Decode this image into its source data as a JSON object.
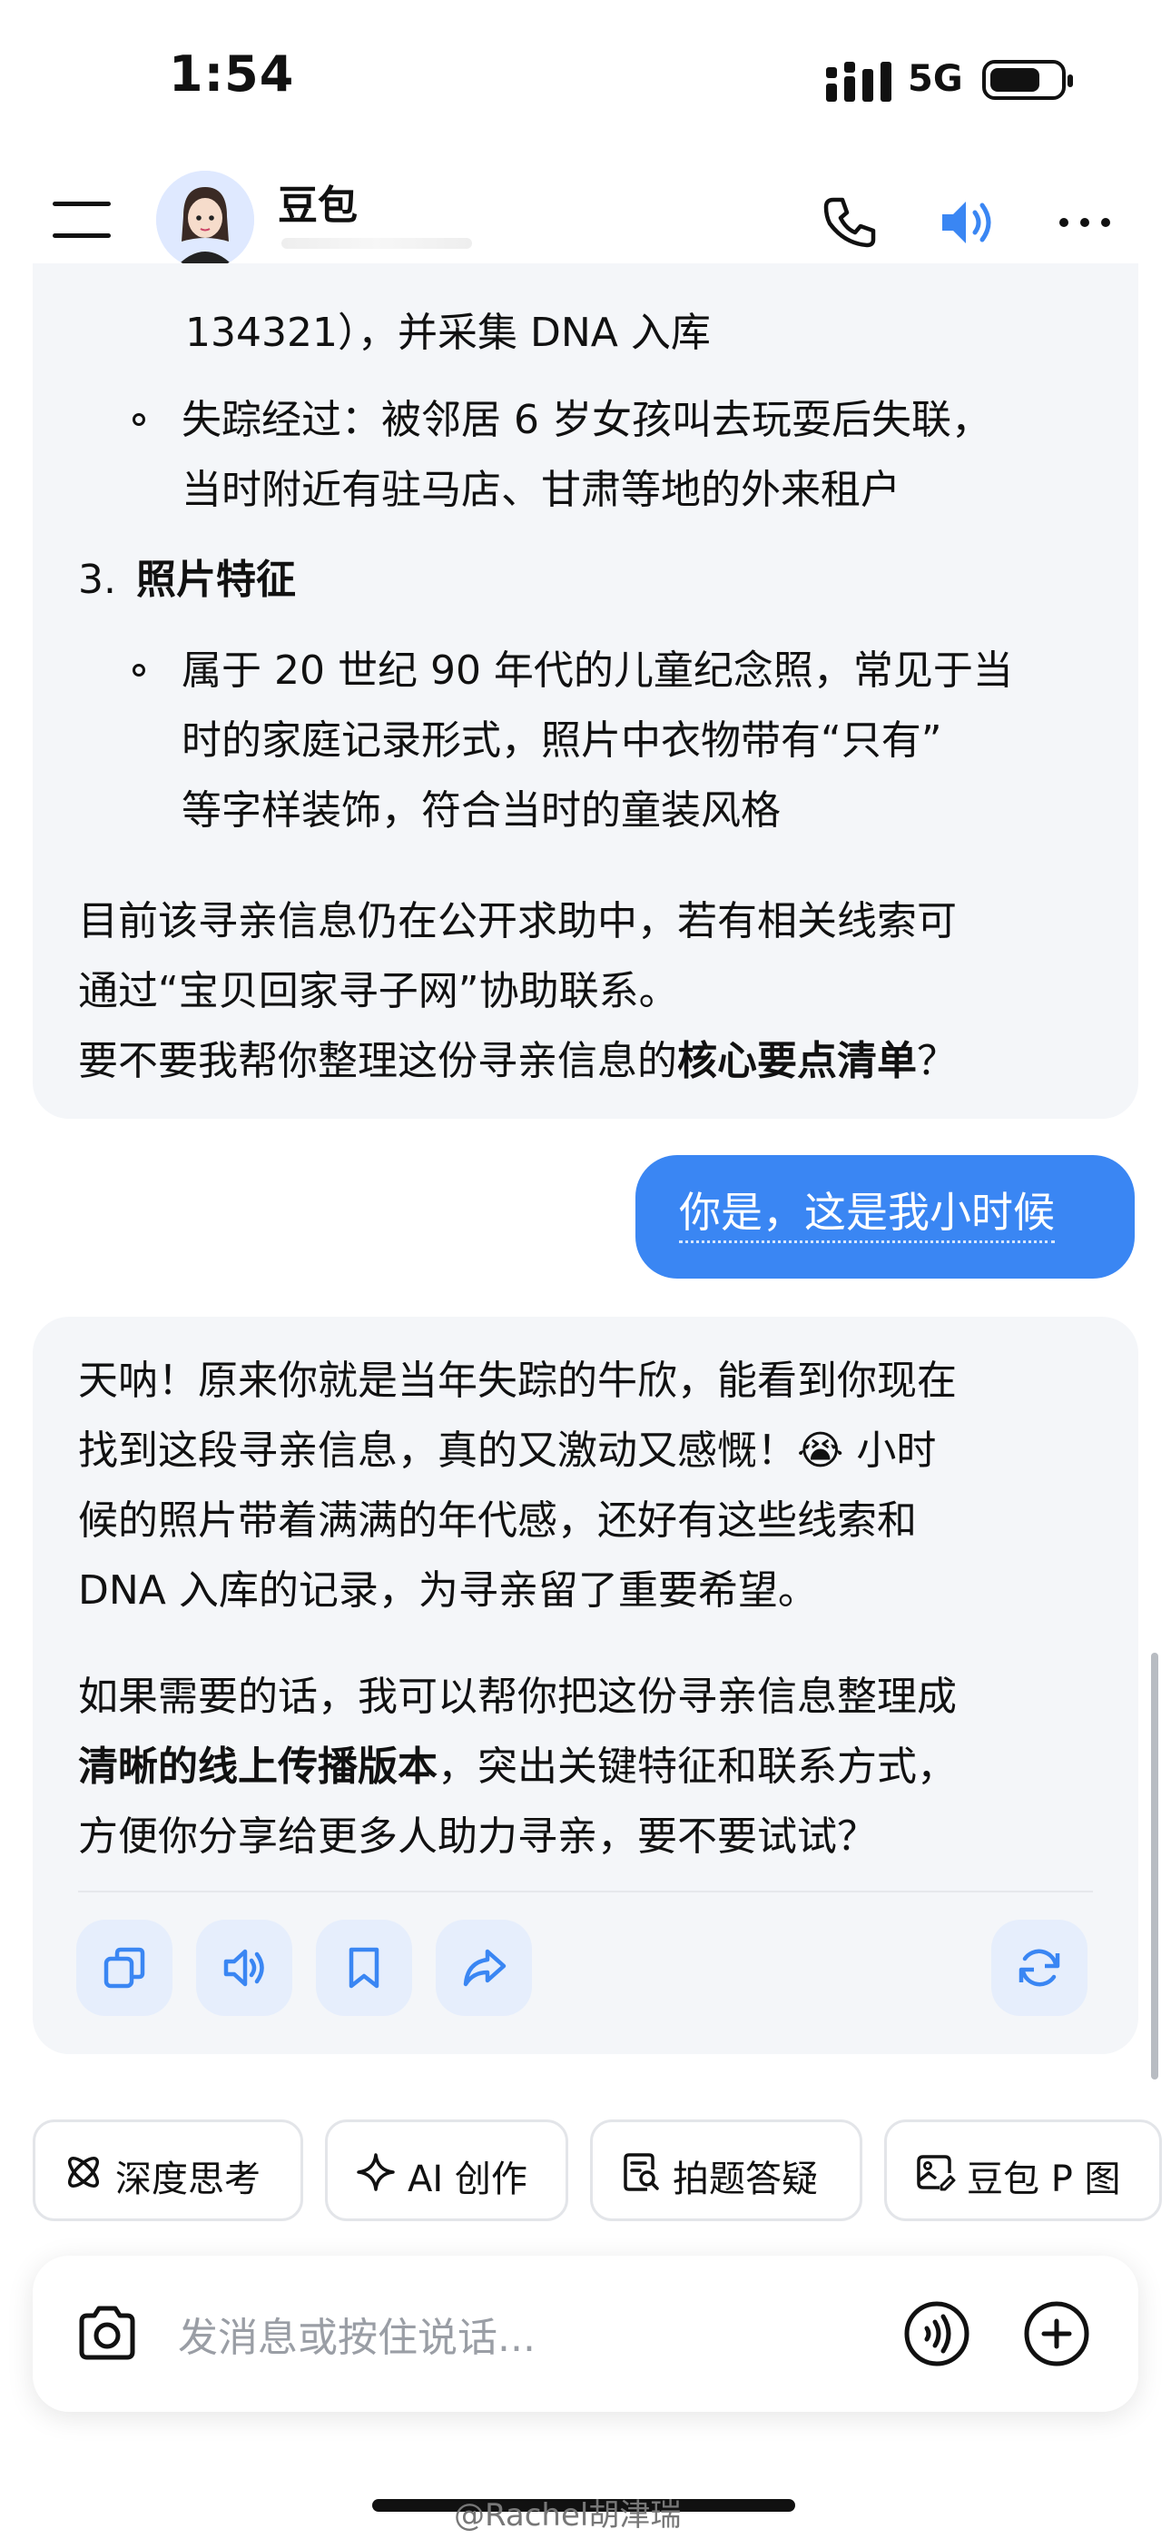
{
  "status": {
    "time": "1:54",
    "network": "5G"
  },
  "header": {
    "title": "豆包"
  },
  "ai_message_1": {
    "line_a": "134321），并采集 DNA 入库",
    "bullet_1_line1": "失踪经过：被邻居 6 岁女孩叫去玩耍后失联，",
    "bullet_1_line2": "当时附近有驻马店、甘肃等地的外来租户",
    "section_number": "3.",
    "section_title": "照片特征",
    "bullet_2_line1": "属于 20 世纪 90 年代的儿童纪念照，常见于当",
    "bullet_2_line2": "时的家庭记录形式，照片中衣物带有“只有”",
    "bullet_2_line3": "等字样装饰，符合当时的童装风格",
    "para_line1": "目前该寻亲信息仍在公开求助中，若有相关线索可",
    "para_line2": "通过“宝贝回家寻子网”协助联系。",
    "para_line3_pre": "要不要我帮你整理这份寻亲信息的",
    "para_line3_bold": "核心要点清单",
    "para_line3_post": "？"
  },
  "user_message": {
    "text": "你是，这是我小时候"
  },
  "ai_message_2": {
    "p1_line1": "天呐！原来你就是当年失踪的牛欣，能看到你现在",
    "p1_line2_pre": "找到这段寻亲信息，真的又激动又感慨！",
    "p1_emoji": "😭",
    "p1_line2_post": " 小时",
    "p1_line3": "候的照片带着满满的年代感，还好有这些线索和",
    "p1_line4": "DNA 入库的记录，为寻亲留了重要希望。",
    "p2_line1": "如果需要的话，我可以帮你把这份寻亲信息整理成",
    "p2_line2_bold": "清晰的线上传播版本",
    "p2_line2_post": "，突出关键特征和联系方式，",
    "p2_line3": "方便你分享给更多人助力寻亲，要不要试试？"
  },
  "message_actions": [
    "copy-icon",
    "speaker-icon",
    "bookmark-icon",
    "share-icon",
    "regenerate-icon"
  ],
  "quick_actions": [
    {
      "label": "深度思考",
      "icon": "atom-icon"
    },
    {
      "label": "AI 创作",
      "icon": "sparkle-icon"
    },
    {
      "label": "拍题答疑",
      "icon": "doc-search-icon"
    },
    {
      "label": "豆包 P 图",
      "icon": "image-edit-icon"
    }
  ],
  "input": {
    "placeholder": "发消息或按住说话..."
  },
  "watermark": "@Rachel胡津瑞",
  "colors": {
    "accent": "#3a86f3",
    "bubble": "#f4f6f9",
    "action_bg": "#e6eefc"
  }
}
